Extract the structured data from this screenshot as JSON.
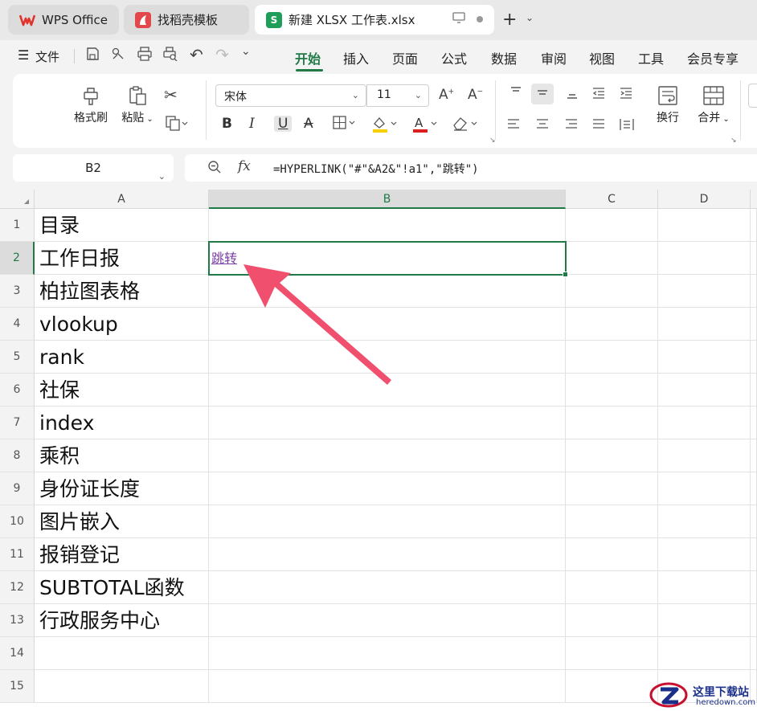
{
  "tabs": [
    {
      "label": "WPS Office",
      "icon": "wps-logo-icon"
    },
    {
      "label": "找稻壳模板",
      "icon": "docer-icon"
    },
    {
      "label": "新建 XLSX 工作表.xlsx",
      "icon": "spreadsheet-s-icon",
      "active": true
    }
  ],
  "menu": {
    "file_label": "文件",
    "items": [
      "开始",
      "插入",
      "页面",
      "公式",
      "数据",
      "审阅",
      "视图",
      "工具",
      "会员专享"
    ],
    "active": "开始"
  },
  "ribbon": {
    "format_painter": "格式刷",
    "paste": "粘贴",
    "font_name": "宋体",
    "font_size": "11",
    "wrap_text": "换行",
    "merge": "合并"
  },
  "formula_bar": {
    "name_box": "B2",
    "fx": "fx",
    "formula": "=HYPERLINK(\"#\"&A2&\"!a1\",\"跳转\")"
  },
  "sheet": {
    "columns": [
      "A",
      "B",
      "C",
      "D"
    ],
    "selected_column": "B",
    "selected_row": "2",
    "rows": [
      {
        "num": "1",
        "a": "目录",
        "b": ""
      },
      {
        "num": "2",
        "a": "工作日报",
        "b": "跳转"
      },
      {
        "num": "3",
        "a": "柏拉图表格",
        "b": ""
      },
      {
        "num": "4",
        "a": "vlookup",
        "b": ""
      },
      {
        "num": "5",
        "a": "rank",
        "b": ""
      },
      {
        "num": "6",
        "a": "社保",
        "b": ""
      },
      {
        "num": "7",
        "a": "index",
        "b": ""
      },
      {
        "num": "8",
        "a": "乘积",
        "b": ""
      },
      {
        "num": "9",
        "a": "身份证长度",
        "b": ""
      },
      {
        "num": "10",
        "a": "图片嵌入",
        "b": ""
      },
      {
        "num": "11",
        "a": "报销登记",
        "b": ""
      },
      {
        "num": "12",
        "a": "SUBTOTAL函数",
        "b": ""
      },
      {
        "num": "13",
        "a": "行政服务中心",
        "b": ""
      },
      {
        "num": "14",
        "a": "",
        "b": ""
      },
      {
        "num": "15",
        "a": "",
        "b": ""
      }
    ]
  },
  "watermark": {
    "title": "这里下载站",
    "url": "heredown.com"
  },
  "colors": {
    "accent": "#1f7a45",
    "arrow": "#f0506e",
    "link": "#7b3ea6"
  }
}
